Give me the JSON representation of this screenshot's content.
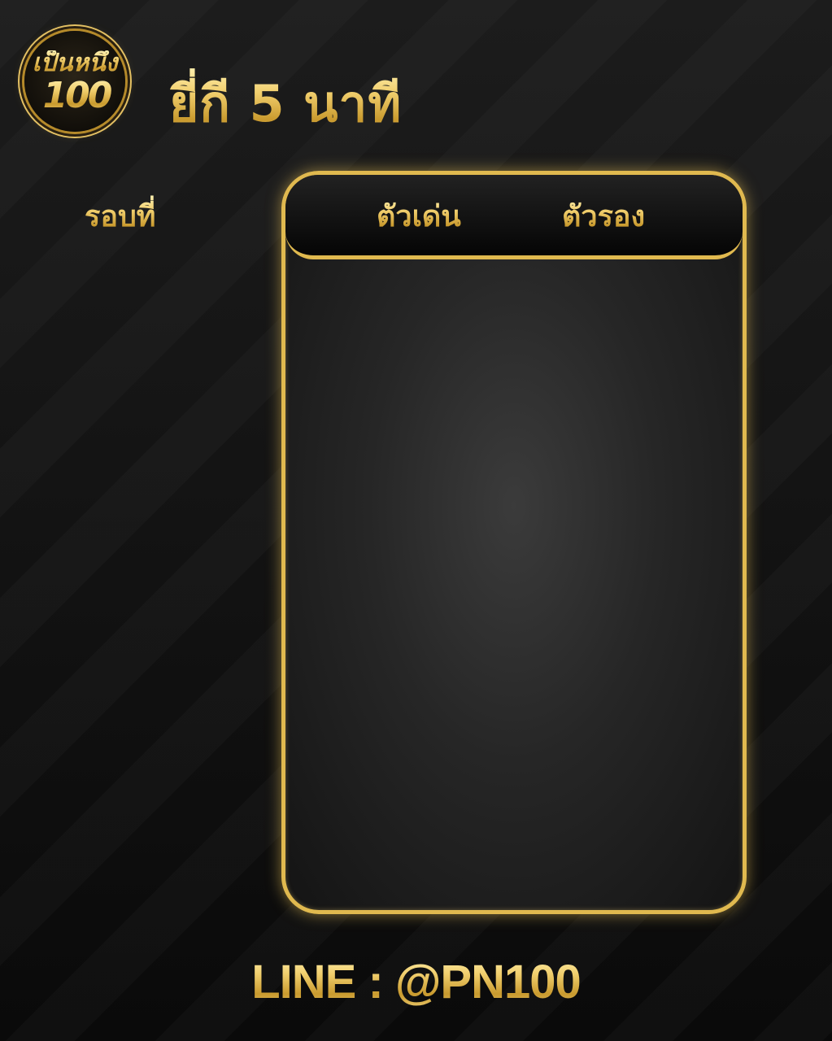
{
  "logo": {
    "thai_text": "เป็นหนึ่ง",
    "number_text": "100",
    "ring_color": "#e3c063"
  },
  "title": "ยี่กี 5 นาที",
  "round_label": "รอบที่",
  "board": {
    "column_main": "ตัวเด่น",
    "column_sub": "ตัวรอง",
    "border_color": "#e0b94f"
  },
  "footer": {
    "line_contact": "LINE : @PN100"
  },
  "colors": {
    "gold_light": "#fff2b3",
    "gold": "#f1cf6e",
    "gold_dark": "#c99a2e",
    "background": "#0c0c0c"
  }
}
